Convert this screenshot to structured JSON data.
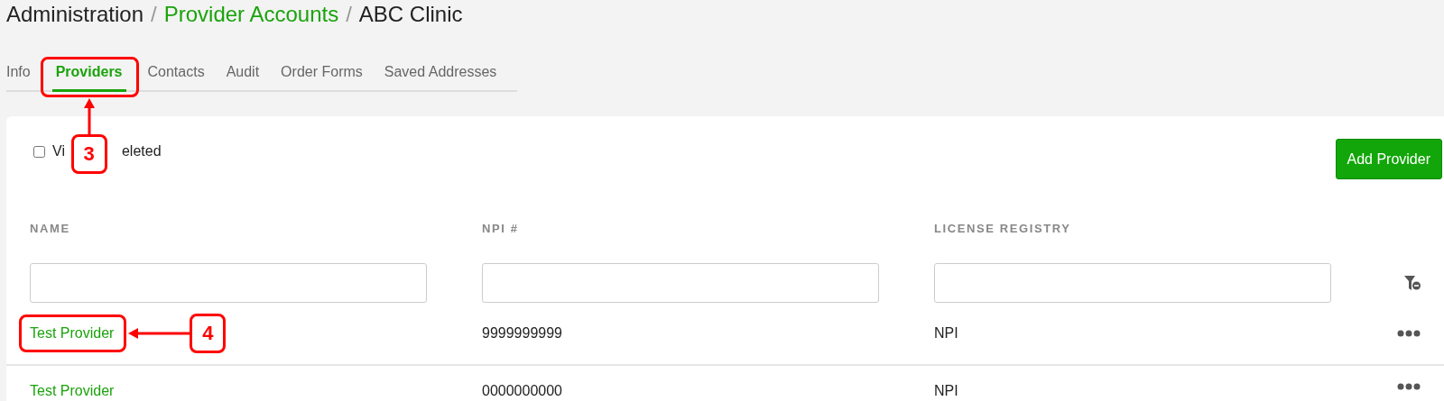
{
  "breadcrumb": [
    {
      "text": "Administration",
      "link": false
    },
    {
      "text": "Provider Accounts",
      "link": true,
      "separator": "/"
    },
    {
      "text": "ABC Clinic",
      "link": false,
      "separator": "/"
    }
  ],
  "tabs": [
    {
      "label": "Info",
      "selected": false
    },
    {
      "label": "Providers",
      "selected": true,
      "callout": "3"
    },
    {
      "label": "Contacts",
      "selected": false
    },
    {
      "label": "Audit",
      "selected": false
    },
    {
      "label": "Order Forms",
      "selected": false
    },
    {
      "label": "Saved Addresses",
      "selected": false
    }
  ],
  "view_deleted": {
    "checked": false,
    "label_parts": [
      "Vi",
      "eleted"
    ]
  },
  "add_button": "Add Provider",
  "table": {
    "columns": [
      "NAME",
      "NPI #",
      "LICENSE REGISTRY"
    ],
    "rows": [
      {
        "name": "Test Provider",
        "npi": "9999999999",
        "license": "NPI",
        "callout": "4"
      },
      {
        "name": "Test Provider",
        "npi": "0000000000",
        "license": "NPI"
      }
    ]
  }
}
